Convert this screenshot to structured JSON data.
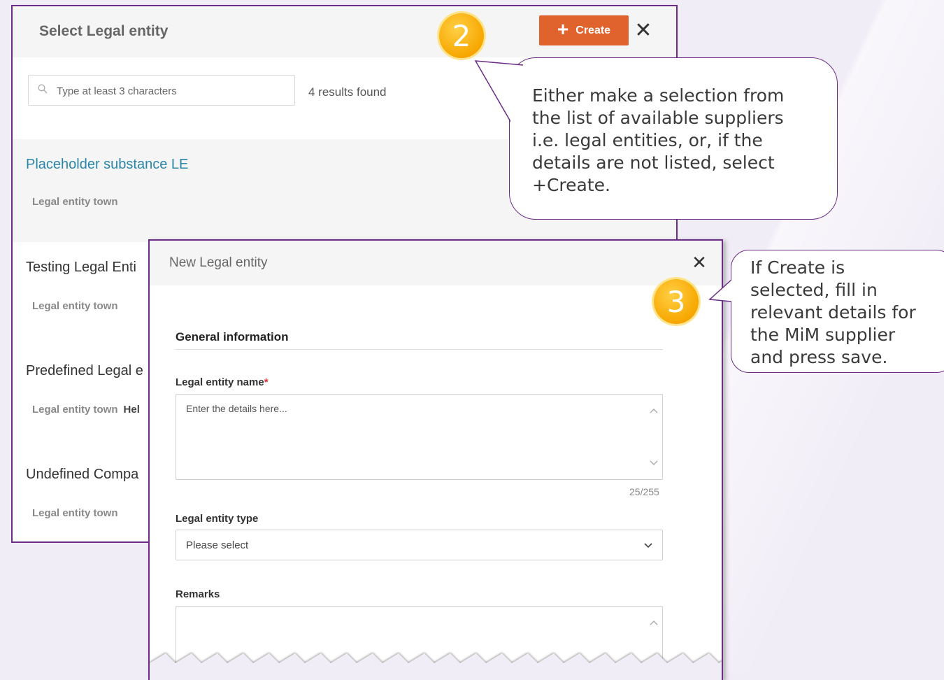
{
  "select_dialog": {
    "title": "Select Legal entity",
    "create_label": "Create",
    "create_icon": "+",
    "close_icon": "✕",
    "search_placeholder": "Type at least 3 characters",
    "results_text": "4 results found",
    "rows": [
      {
        "name": "Placeholder substance LE",
        "town_label": "Legal entity town",
        "town_value": ""
      },
      {
        "name": "Testing Legal Enti",
        "town_label": "Legal entity town",
        "town_value": ""
      },
      {
        "name": "Predefined Legal e",
        "town_label": "Legal entity town",
        "town_value": "Hel"
      },
      {
        "name": "Undefined Compa",
        "town_label": "Legal entity town",
        "town_value": ""
      }
    ]
  },
  "new_dialog": {
    "title": "New Legal entity",
    "close_icon": "✕",
    "section_title": "General information",
    "name_label": "Legal entity name",
    "required_mark": "*",
    "name_placeholder": "Enter the details here...",
    "counter": "25/255",
    "type_label": "Legal entity type",
    "type_value": "Please select",
    "remarks_label": "Remarks"
  },
  "annotations": {
    "badge_2": "2",
    "badge_3": "3",
    "callout_2": "Either make a selection from\nthe list of available suppliers\ni.e. legal entities, or, if the\ndetails are not listed, select\n+Create.",
    "callout_3": "If Create is\nselected, fill in\nrelevant details for\nthe MiM supplier\nand press save."
  },
  "colors": {
    "accent_purple": "#6b2d86",
    "create_orange": "#e0622c",
    "link_blue": "#2a86a8",
    "badge_gold": "#f7a700",
    "page_bg": "#f1edf7"
  }
}
